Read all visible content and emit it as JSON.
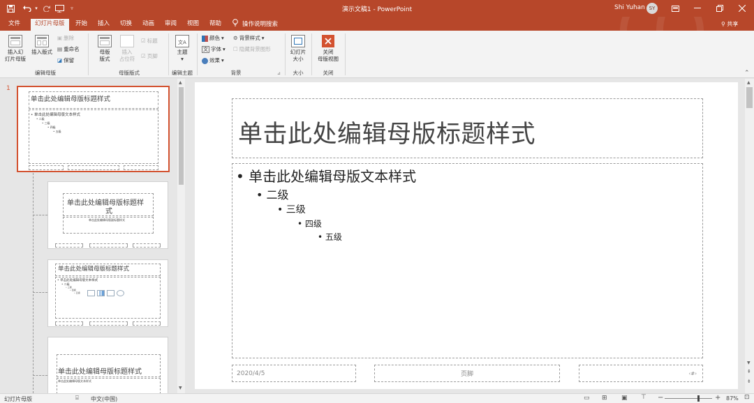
{
  "titlebar": {
    "document_title": "演示文稿1 - PowerPoint",
    "user_name": "Shi Yuhan",
    "user_initials": "SY",
    "quick_access": [
      "save-icon",
      "undo-icon",
      "redo-icon",
      "start-from-beginning-icon",
      "customize-qat-icon"
    ]
  },
  "tabs": {
    "items": [
      "文件",
      "幻灯片母版",
      "开始",
      "插入",
      "切换",
      "动画",
      "审阅",
      "视图",
      "帮助"
    ],
    "active": "幻灯片母版",
    "search": "操作说明搜索",
    "share": "共享"
  },
  "ribbon": {
    "edit_master": {
      "insert_master_line1": "插入幻",
      "insert_master_line2": "灯片母版",
      "insert_layout": "插入版式",
      "delete": "删除",
      "rename": "重命名",
      "preserve": "保留",
      "label": "编辑母版"
    },
    "master_layout": {
      "master_layout_line1": "母版",
      "master_layout_line2": "版式",
      "insert_placeholder_line1": "插入",
      "insert_placeholder_line2": "占位符",
      "title": "标题",
      "footer": "页脚",
      "label": "母版版式"
    },
    "edit_theme": {
      "themes": "主题",
      "label": "编辑主题"
    },
    "background": {
      "colors": "颜色",
      "fonts": "字体",
      "effects": "效果",
      "bg_styles": "背景样式",
      "hide_bg": "隐藏背景图形",
      "label": "背景"
    },
    "size": {
      "slide_size_line1": "幻灯片",
      "slide_size_line2": "大小",
      "label": "大小"
    },
    "close": {
      "close_line1": "关闭",
      "close_line2": "母版视图",
      "label": "关闭"
    }
  },
  "thumbnails": {
    "slide_number": "1",
    "t1_title": "单击此处编辑母版标题样式",
    "t1_bullets": [
      "• 单击此处编辑母版文本样式",
      "• 二级",
      "• 三级",
      "• 四级",
      "• 五级"
    ],
    "t2_title_line1": "单击此处编辑母版标题样",
    "t2_title_line2": "式",
    "t2_subtitle": "单击此处编辑母版副标题样式",
    "t3_title": "单击此处编辑母版标题样式",
    "t3_bullets": [
      "• 单击此处编辑母版文本样式",
      "• 二级",
      "• 三级",
      "• 四级",
      "• 五级"
    ],
    "t4_title": "单击此处编辑母版标题样式",
    "t4_subtitle": "单击此处编辑母版文本样式"
  },
  "slide": {
    "title": "单击此处编辑母版标题样式",
    "bullets": [
      {
        "text": "单击此处编辑母版文本样式",
        "level": 1
      },
      {
        "text": "二级",
        "level": 2
      },
      {
        "text": "三级",
        "level": 3
      },
      {
        "text": "四级",
        "level": 4
      },
      {
        "text": "五级",
        "level": 5
      }
    ],
    "footer_date": "2020/4/5",
    "footer_text": "页脚",
    "footer_number": "‹#›"
  },
  "statusbar": {
    "mode": "幻灯片母版",
    "language": "中文(中国)",
    "zoom": "87%",
    "zoom_fraction": 0.7
  },
  "colors": {
    "accent": "#b7472a",
    "selection": "#d35230"
  }
}
